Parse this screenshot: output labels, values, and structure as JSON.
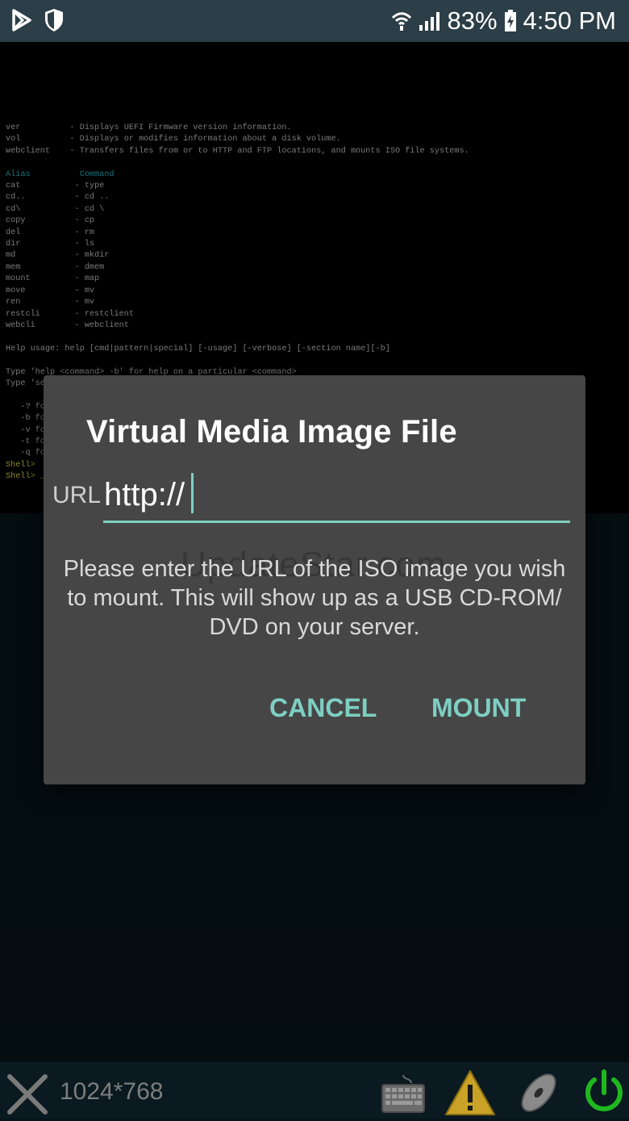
{
  "status_bar": {
    "battery": "83%",
    "time": "4:50 PM"
  },
  "terminal": {
    "lines": [
      {
        "text": "ver          - Displays UEFI Firmware version information.",
        "color": "normal"
      },
      {
        "text": "vol          - Displays or modifies information about a disk volume.",
        "color": "normal"
      },
      {
        "text": "webclient    - Transfers files from or to HTTP and FTP locations, and mounts ISO file systems.",
        "color": "normal"
      },
      {
        "text": "",
        "color": "normal"
      },
      {
        "text": "Alias          Command",
        "color": "cyan"
      },
      {
        "text": "cat           - type",
        "color": "normal"
      },
      {
        "text": "cd..          - cd ..",
        "color": "normal"
      },
      {
        "text": "cd\\           - cd \\",
        "color": "normal"
      },
      {
        "text": "copy          - cp",
        "color": "normal"
      },
      {
        "text": "del           - rm",
        "color": "normal"
      },
      {
        "text": "dir           - ls",
        "color": "normal"
      },
      {
        "text": "md            - mkdir",
        "color": "normal"
      },
      {
        "text": "mem           - dmem",
        "color": "normal"
      },
      {
        "text": "mount         - map",
        "color": "normal"
      },
      {
        "text": "move          - mv",
        "color": "normal"
      },
      {
        "text": "ren           - mv",
        "color": "normal"
      },
      {
        "text": "restcli       - restclient",
        "color": "normal"
      },
      {
        "text": "webcli        - webclient",
        "color": "normal"
      },
      {
        "text": "",
        "color": "normal"
      },
      {
        "text": "Help usage: help [cmd|pattern|special] [-usage] [-verbose] [-section name][-b]",
        "color": "normal"
      },
      {
        "text": "",
        "color": "normal"
      },
      {
        "text": "Type 'help <command> -b' for help on a particular <command>",
        "color": "normal"
      },
      {
        "text": "Type 'se",
        "color": "normal"
      },
      {
        "text": "",
        "color": "normal"
      },
      {
        "text": "   -? fo",
        "color": "normal"
      },
      {
        "text": "   -b fo",
        "color": "normal"
      },
      {
        "text": "   -v fo",
        "color": "normal"
      },
      {
        "text": "   -t fo",
        "color": "normal"
      },
      {
        "text": "   -q fo",
        "color": "normal"
      },
      {
        "text": "Shell>",
        "color": "yellow"
      },
      {
        "text": "Shell> _",
        "color": "yellow"
      }
    ]
  },
  "dialog": {
    "title": "Virtual Media Image File",
    "url_label": "URL",
    "url_value": "http://",
    "message": "Please enter the URL of the ISO image you wish to mount. This will show up as a USB CD-ROM/ DVD on your server.",
    "watermark": "UpdateStar.com",
    "cancel_label": "CANCEL",
    "mount_label": "MOUNT"
  },
  "toolbar": {
    "resolution": "1024*768",
    "icons": [
      "close-icon",
      "keyboard-icon",
      "warning-icon",
      "disc-icon",
      "power-icon"
    ]
  },
  "colors": {
    "accent": "#7ecfc3",
    "dialog_bg": "#464646",
    "power": "#1fb81f",
    "warning": "#c9a227"
  }
}
